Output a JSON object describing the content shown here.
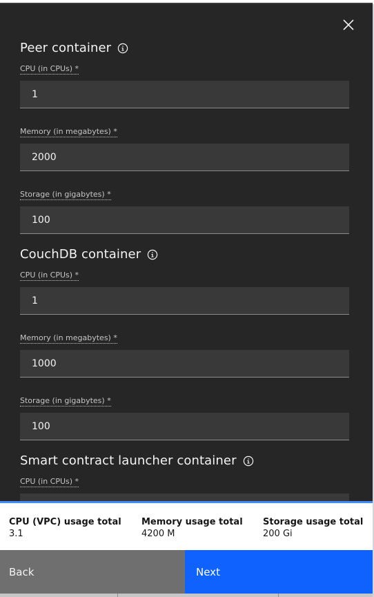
{
  "sections": [
    {
      "title": "Peer container",
      "fields": [
        {
          "label": "CPU (in CPUs) *",
          "value": "1"
        },
        {
          "label": "Memory (in megabytes) *",
          "value": "2000"
        },
        {
          "label": "Storage (in gigabytes) *",
          "value": "100"
        }
      ]
    },
    {
      "title": "CouchDB container",
      "fields": [
        {
          "label": "CPU (in CPUs) *",
          "value": "1"
        },
        {
          "label": "Memory (in megabytes) *",
          "value": "1000"
        },
        {
          "label": "Storage (in gigabytes) *",
          "value": "100"
        }
      ]
    },
    {
      "title": "Smart contract launcher container",
      "fields": [
        {
          "label": "CPU (in CPUs) *",
          "value": ""
        }
      ]
    }
  ],
  "summary": {
    "cpu": {
      "label": "CPU (VPC) usage total",
      "value": "3.1"
    },
    "memory": {
      "label": "Memory usage total",
      "value": "4200 M"
    },
    "storage": {
      "label": "Storage usage total",
      "value": "200 Gi"
    }
  },
  "buttons": {
    "back": "Back",
    "next": "Next"
  },
  "icons": {
    "close": "close-icon",
    "info": "information-icon"
  },
  "colors": {
    "panel": "#262626",
    "field": "#393939",
    "primary": "#0f62fe",
    "secondary": "#6f6f6f",
    "summary_accent": "#3d8bfd"
  }
}
